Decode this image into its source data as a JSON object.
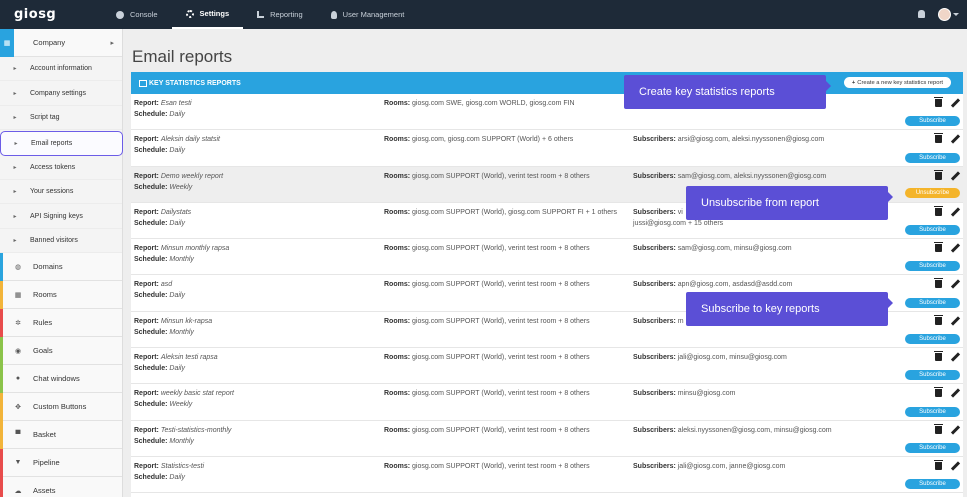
{
  "topbar": {
    "logo": "giosg",
    "nav": [
      {
        "label": "Console",
        "icon": "dashboard-icon"
      },
      {
        "label": "Settings",
        "icon": "gear-icon"
      },
      {
        "label": "Reporting",
        "icon": "bar-chart-icon"
      },
      {
        "label": "User Management",
        "icon": "user-icon"
      }
    ],
    "active_nav": "Settings"
  },
  "sidebar": {
    "company": {
      "label": "Company",
      "icon": "building-icon"
    },
    "company_items": [
      {
        "label": "Account information"
      },
      {
        "label": "Company settings"
      },
      {
        "label": "Script tag"
      },
      {
        "label": "Email reports"
      },
      {
        "label": "Access tokens"
      },
      {
        "label": "Your sessions"
      },
      {
        "label": "API Signing keys"
      },
      {
        "label": "Banned visitors"
      }
    ],
    "active_item": "Email reports",
    "sections": [
      {
        "label": "Domains",
        "icon": "globe-icon",
        "color": "#2aa4de"
      },
      {
        "label": "Rooms",
        "icon": "grid-icon",
        "color": "#f2b43a"
      },
      {
        "label": "Rules",
        "icon": "cogs-icon",
        "color": "#e84c4c"
      },
      {
        "label": "Goals",
        "icon": "target-icon",
        "color": "#8bc34a"
      },
      {
        "label": "Chat windows",
        "icon": "chat-icon",
        "color": "#8bc34a"
      },
      {
        "label": "Custom Buttons",
        "icon": "cursor-icon",
        "color": "#f2b43a"
      },
      {
        "label": "Basket",
        "icon": "cart-icon",
        "color": "#f2b43a"
      },
      {
        "label": "Pipeline",
        "icon": "filter-icon",
        "color": "#e84c4c"
      },
      {
        "label": "Assets",
        "icon": "cloud-icon",
        "color": "#e84c4c"
      }
    ]
  },
  "main": {
    "title": "Email reports",
    "panel_title": "KEY STATISTICS REPORTS",
    "create_label": "Create a new key statistics report",
    "labels": {
      "report": "Report:",
      "schedule": "Schedule:",
      "rooms": "Rooms:",
      "subscribers": "Subscribers:"
    },
    "subscribe_label": "Subscribe",
    "unsubscribe_label": "Unsubscribe",
    "rows": [
      {
        "report": "Esan testi",
        "schedule": "Daily",
        "rooms": "giosg.com SWE, giosg.com WORLD, giosg.com FIN",
        "subscribers": "",
        "state": "subscribe"
      },
      {
        "report": "Aleksin daily statsit",
        "schedule": "Daily",
        "rooms": "giosg.com, giosg.com SUPPORT (World) + 6 others",
        "subscribers": "arsi@giosg.com, aleksi.nyyssonen@giosg.com",
        "state": "subscribe"
      },
      {
        "report": "Demo weekly report",
        "schedule": "Weekly",
        "rooms": "giosg.com SUPPORT (World), verint test room + 8 others",
        "subscribers": "sam@giosg.com, aleksi.nyyssonen@giosg.com",
        "state": "unsubscribe"
      },
      {
        "report": "Dailystats",
        "schedule": "Daily",
        "rooms": "giosg.com SUPPORT (World), giosg.com SUPPORT FI + 1 others",
        "subscribers": "vi",
        "subscribers2": "jussi@giosg.com + 15 others",
        "state": "subscribe"
      },
      {
        "report": "Minsun monthly rapsa",
        "schedule": "Monthly",
        "rooms": "giosg.com SUPPORT (World), verint test room + 8 others",
        "subscribers": "sam@giosg.com, minsu@giosg.com",
        "state": "subscribe"
      },
      {
        "report": "asd",
        "schedule": "Daily",
        "rooms": "giosg.com SUPPORT (World), verint test room + 8 others",
        "subscribers": "apn@giosg.com, asdasd@asdd.com",
        "state": "subscribe"
      },
      {
        "report": "Minsun kk-rapsa",
        "schedule": "Monthly",
        "rooms": "giosg.com SUPPORT (World), verint test room + 8 others",
        "subscribers": "m",
        "state": "subscribe"
      },
      {
        "report": "Aleksin testi rapsa",
        "schedule": "Daily",
        "rooms": "giosg.com SUPPORT (World), verint test room + 8 others",
        "subscribers": "jali@giosg.com, minsu@giosg.com",
        "state": "subscribe"
      },
      {
        "report": "weekly basic stat report",
        "schedule": "Weekly",
        "rooms": "giosg.com SUPPORT (World), verint test room + 8 others",
        "subscribers": "minsu@giosg.com",
        "state": "subscribe"
      },
      {
        "report": "Testi-statistics-monthly",
        "schedule": "Monthly",
        "rooms": "giosg.com SUPPORT (World), verint test room + 8 others",
        "subscribers": "aleksi.nyyssonen@giosg.com, minsu@giosg.com",
        "state": "subscribe"
      },
      {
        "report": "Statistics-testi",
        "schedule": "Daily",
        "rooms": "giosg.com SUPPORT (World), verint test room + 8 others",
        "subscribers": "jali@giosg.com, janne@giosg.com",
        "state": "subscribe"
      }
    ]
  },
  "callouts": {
    "create": "Create key statistics reports",
    "unsubscribe": "Unsubscribe from report",
    "subscribe": "Subscribe to key reports"
  }
}
